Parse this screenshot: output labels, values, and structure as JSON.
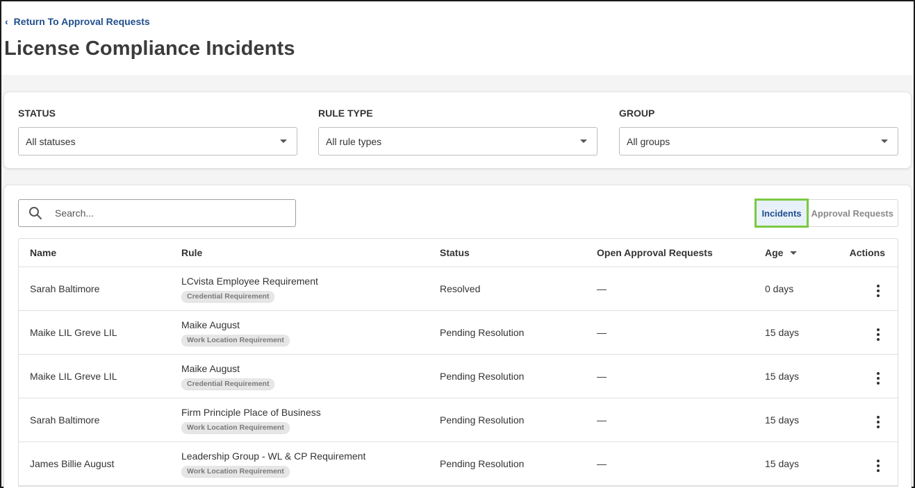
{
  "header": {
    "back_link": "Return To Approval Requests",
    "title": "License Compliance Incidents"
  },
  "filters": {
    "status": {
      "label": "STATUS",
      "value": "All statuses"
    },
    "rule_type": {
      "label": "RULE TYPE",
      "value": "All rule types"
    },
    "group": {
      "label": "GROUP",
      "value": "All groups"
    }
  },
  "search": {
    "placeholder": "Search..."
  },
  "toggle": {
    "incidents": "Incidents",
    "approval_requests": "Approval Requests"
  },
  "table": {
    "columns": {
      "name": "Name",
      "rule": "Rule",
      "status": "Status",
      "open_requests": "Open Approval Requests",
      "age": "Age",
      "actions": "Actions"
    },
    "rows": [
      {
        "name": "Sarah Baltimore",
        "rule": "LCvista Employee Requirement",
        "rule_type": "Credential Requirement",
        "status": "Resolved",
        "open": "—",
        "age": "0 days"
      },
      {
        "name": "Maike LIL Greve LIL",
        "rule": "Maike August",
        "rule_type": "Work Location Requirement",
        "status": "Pending Resolution",
        "open": "—",
        "age": "15 days"
      },
      {
        "name": "Maike LIL Greve LIL",
        "rule": "Maike August",
        "rule_type": "Credential Requirement",
        "status": "Pending Resolution",
        "open": "—",
        "age": "15 days"
      },
      {
        "name": "Sarah Baltimore",
        "rule": "Firm Principle Place of Business",
        "rule_type": "Work Location Requirement",
        "status": "Pending Resolution",
        "open": "—",
        "age": "15 days"
      },
      {
        "name": "James Billie August",
        "rule": "Leadership Group - WL & CP Requirement",
        "rule_type": "Work Location Requirement",
        "status": "Pending Resolution",
        "open": "—",
        "age": "15 days"
      }
    ]
  },
  "colors": {
    "link": "#1f4e8c",
    "active_toggle_bg": "#e8f0f9",
    "highlight_outline": "#7ac943"
  }
}
